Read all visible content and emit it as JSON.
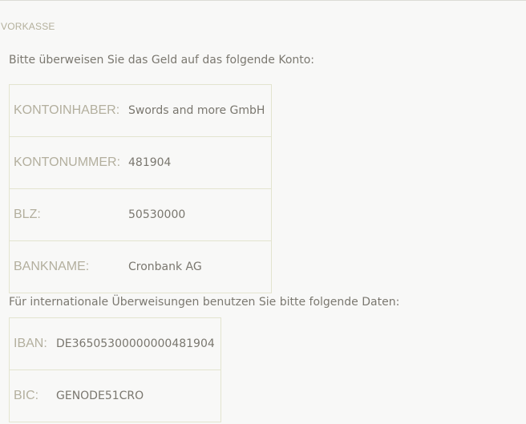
{
  "section": {
    "title": "VORKASSE"
  },
  "domestic": {
    "intro": "Bitte überweisen Sie das Geld auf das folgende Konto:",
    "rows": [
      {
        "label": "KONTOINHABER:",
        "value": "Swords and more GmbH"
      },
      {
        "label": "KONTONUMMER:",
        "value": "481904"
      },
      {
        "label": "BLZ:",
        "value": "50530000"
      },
      {
        "label": "BANKNAME:",
        "value": "Cronbank AG"
      }
    ]
  },
  "international": {
    "intro": "Für internationale Überweisungen benutzen Sie bitte folgende Daten:",
    "rows": [
      {
        "label": "IBAN:",
        "value": "DE36505300000000481904"
      },
      {
        "label": "BIC:",
        "value": "GENODE51CRO"
      }
    ]
  },
  "colors": {
    "background": "#f8f8f7",
    "border": "#e3e4cf",
    "label_text": "#b3af9e",
    "value_text": "#7a776f"
  }
}
